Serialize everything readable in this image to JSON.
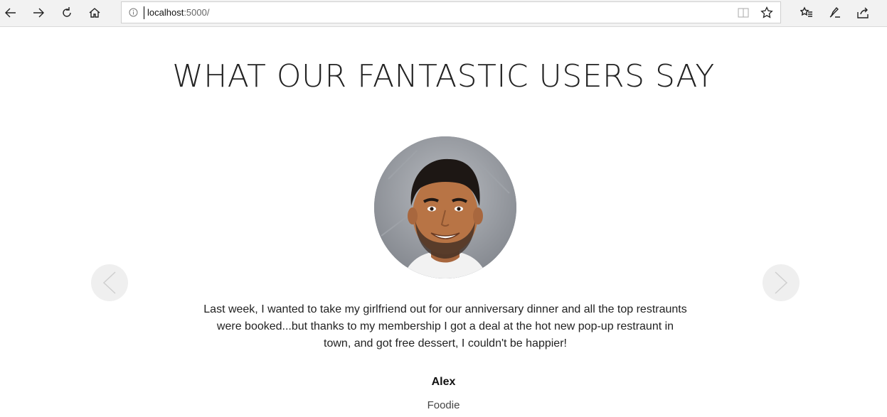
{
  "browser": {
    "url_host": "localhost",
    "url_path": ":5000/",
    "icons": [
      "back-icon",
      "forward-icon",
      "refresh-icon",
      "home-icon",
      "info-icon",
      "reading-view-icon",
      "favorite-star-icon",
      "favorites-icon",
      "notes-icon",
      "share-icon"
    ]
  },
  "page": {
    "title": "WHAT OUR FANTASTIC USERS SAY"
  },
  "testimonial": {
    "quote": "Last week, I wanted to take my girlfriend out for our anniversary dinner and all the top restraunts were booked...but thanks to my membership I got a deal at the hot new pop-up restraunt in town, and got free dessert, I couldn't be happier!",
    "name": "Alex",
    "role": "Foodie"
  },
  "colors": {
    "chrome_bg": "#f2f2f2",
    "arrow_bg": "#efefef",
    "text": "#222222"
  }
}
